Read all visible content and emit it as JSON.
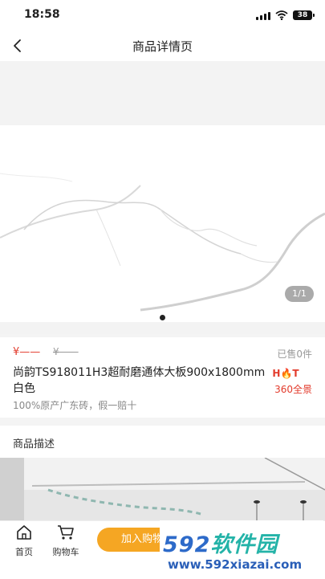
{
  "status": {
    "time": "18:58",
    "battery": "38"
  },
  "nav": {
    "title": "商品详情页"
  },
  "gallery": {
    "page_indicator": "1/1",
    "current_page": 1,
    "total_pages": 1
  },
  "product": {
    "price_now": "¥——",
    "price_old": "¥——",
    "sold": "已售0件",
    "title": "尚韵TS918011H3超耐磨通体大板900x1800mm白色",
    "subtitle": "100%原产广东砖，假一赔十",
    "hot_tag": "H🔥T",
    "vr_tag": "360全景"
  },
  "description": {
    "title": "商品描述"
  },
  "tabbar": {
    "home_label": "首页",
    "cart_label": "购物车",
    "add_to_cart_label": "加入购物车"
  },
  "watermark": {
    "brand_digits_1": "592",
    "brand_text": "软件园",
    "url": "www.592xiazai.com"
  },
  "colors": {
    "accent_red": "#e23b2c",
    "button_orange": "#f5a623",
    "watermark_blue": "#2d6ac9"
  }
}
